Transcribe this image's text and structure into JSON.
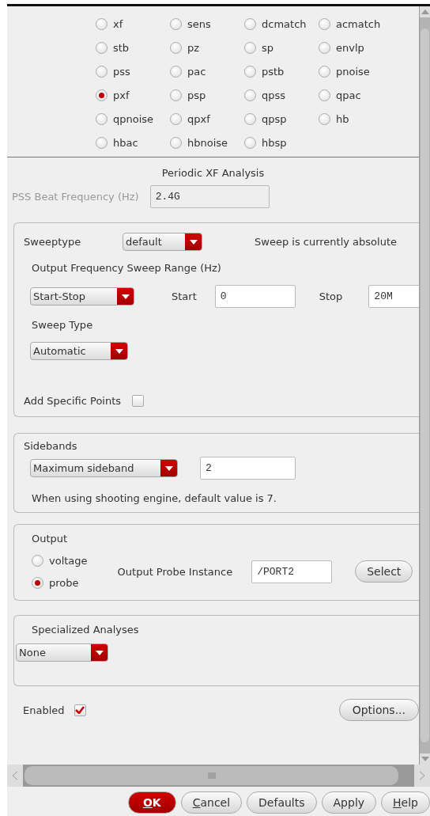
{
  "analyses": [
    {
      "label": "xf",
      "selected": false
    },
    {
      "label": "sens",
      "selected": false
    },
    {
      "label": "dcmatch",
      "selected": false
    },
    {
      "label": "acmatch",
      "selected": false
    },
    {
      "label": "stb",
      "selected": false
    },
    {
      "label": "pz",
      "selected": false
    },
    {
      "label": "sp",
      "selected": false
    },
    {
      "label": "envlp",
      "selected": false
    },
    {
      "label": "pss",
      "selected": false
    },
    {
      "label": "pac",
      "selected": false
    },
    {
      "label": "pstb",
      "selected": false
    },
    {
      "label": "pnoise",
      "selected": false
    },
    {
      "label": "pxf",
      "selected": true
    },
    {
      "label": "psp",
      "selected": false
    },
    {
      "label": "qpss",
      "selected": false
    },
    {
      "label": "qpac",
      "selected": false
    },
    {
      "label": "qpnoise",
      "selected": false
    },
    {
      "label": "qpxf",
      "selected": false
    },
    {
      "label": "qpsp",
      "selected": false
    },
    {
      "label": "hb",
      "selected": false
    },
    {
      "label": "hbac",
      "selected": false
    },
    {
      "label": "hbnoise",
      "selected": false
    },
    {
      "label": "hbsp",
      "selected": false
    }
  ],
  "section_title": "Periodic XF Analysis",
  "beat_frequency": {
    "label": "PSS Beat Frequency (Hz)",
    "value": "2.4G",
    "disabled": true
  },
  "sweep": {
    "sweeptype_label": "Sweeptype",
    "sweeptype": "default",
    "status": "Sweep is currently absolute",
    "range_label": "Output Frequency Sweep Range (Hz)",
    "range_mode": "Start-Stop",
    "start_label": "Start",
    "start": "0",
    "stop_label": "Stop",
    "stop": "20M",
    "sweep_type_label": "Sweep Type",
    "sweep_type": "Automatic",
    "add_points_label": "Add Specific Points",
    "add_points_checked": false
  },
  "sidebands": {
    "title": "Sidebands",
    "mode": "Maximum sideband",
    "value": "2",
    "note": "When using shooting engine, default value is 7."
  },
  "output": {
    "title": "Output",
    "options": [
      {
        "label": "voltage",
        "selected": false
      },
      {
        "label": "probe",
        "selected": true
      }
    ],
    "probe_label": "Output Probe Instance",
    "probe": "/PORT2",
    "select_button": "Select"
  },
  "specialized": {
    "title": "Specialized Analyses",
    "value": "None"
  },
  "enabled": {
    "label": "Enabled",
    "checked": true
  },
  "options_button": "Options...",
  "buttons": [
    {
      "label": "OK",
      "kind": "primary",
      "mnemonic_first": true
    },
    {
      "label": "Cancel",
      "kind": "normal",
      "mnemonic_first": true
    },
    {
      "label": "Defaults",
      "kind": "normal",
      "mnemonic_first": false
    },
    {
      "label": "Apply",
      "kind": "normal",
      "mnemonic_first": false
    },
    {
      "label": "Help",
      "kind": "normal",
      "mnemonic_first": true
    }
  ]
}
